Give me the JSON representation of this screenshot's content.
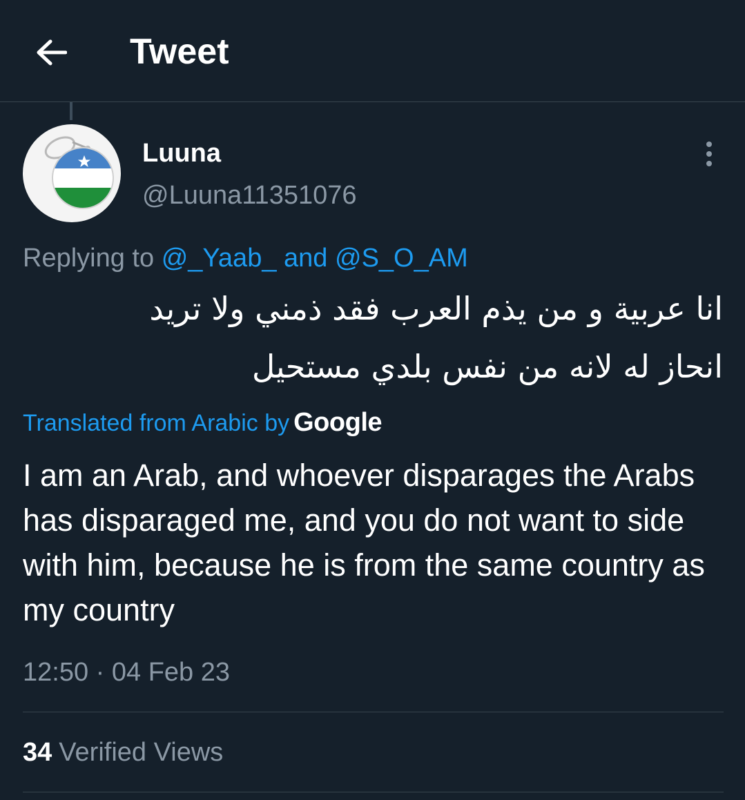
{
  "header": {
    "title": "Tweet",
    "back_icon": "arrow-left-icon"
  },
  "tweet": {
    "author": {
      "display_name": "Luuna",
      "handle": "@Luuna11351076",
      "avatar": "flag-keychain-avatar"
    },
    "replying_to": {
      "prefix": "Replying to",
      "users": [
        "@_Yaab_",
        "@S_O_AM"
      ],
      "conjunction": "and"
    },
    "original_text": "انا عربية و من  يذم العرب فقد  ذمني ولا تريد\nانحاز له لانه من نفس بلدي  مستحيل",
    "translation_label": "Translated from Arabic by",
    "translation_provider": "Google",
    "translated_text": "I am an Arab, and whoever disparages the Arabs has disparaged me, and you do not want to side with him, because he is from the same country as my country",
    "time": "12:50",
    "separator": "·",
    "date": "04 Feb 23",
    "views_count": "34",
    "views_label": "Verified Views"
  },
  "colors": {
    "background": "#15202b",
    "accent": "#1d9bf0",
    "secondary_text": "#8b98a5",
    "divider": "#38444d"
  }
}
